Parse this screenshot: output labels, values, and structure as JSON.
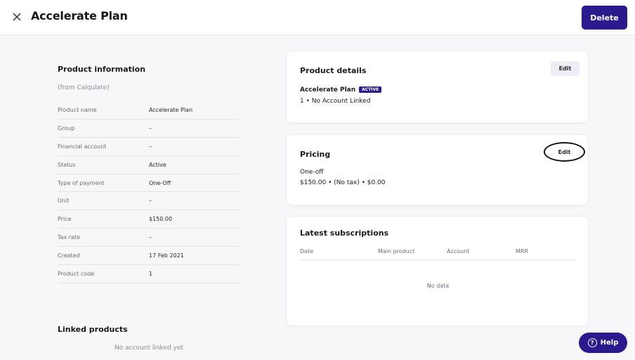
{
  "header": {
    "title": "Accelerate Plan",
    "delete_label": "Delete",
    "close_icon": "close-icon"
  },
  "product_info": {
    "title": "Product information",
    "source": "(from Calqulate)",
    "rows": [
      {
        "label": "Product name",
        "value": "Accelerate Plan"
      },
      {
        "label": "Group",
        "value": "–"
      },
      {
        "label": "Financial account",
        "value": "–"
      },
      {
        "label": "Status",
        "value": "Active"
      },
      {
        "label": "Type of payment",
        "value": "One-Off"
      },
      {
        "label": "Unit",
        "value": "–"
      },
      {
        "label": "Price",
        "value": "$150.00"
      },
      {
        "label": "Tax rate",
        "value": "–"
      },
      {
        "label": "Created",
        "value": "17 Feb 2021"
      },
      {
        "label": "Product code",
        "value": "1"
      }
    ]
  },
  "linked_products": {
    "title": "Linked products",
    "empty": "No account linked yet"
  },
  "product_details": {
    "title": "Product details",
    "edit_label": "Edit",
    "name": "Accelerate Plan",
    "badge": "ACTIVE",
    "summary": "1 • No Account Linked"
  },
  "pricing": {
    "title": "Pricing",
    "edit_label": "Edit",
    "type": "One-off",
    "summary": "$150.00 • (No tax) • $0.00"
  },
  "subscriptions": {
    "title": "Latest subscriptions",
    "columns": [
      "Date",
      "Main product",
      "Account",
      "MRR"
    ],
    "empty": "No data"
  },
  "help": {
    "label": "Help",
    "icon": "question-icon"
  },
  "colors": {
    "accent": "#2a1a8e"
  }
}
